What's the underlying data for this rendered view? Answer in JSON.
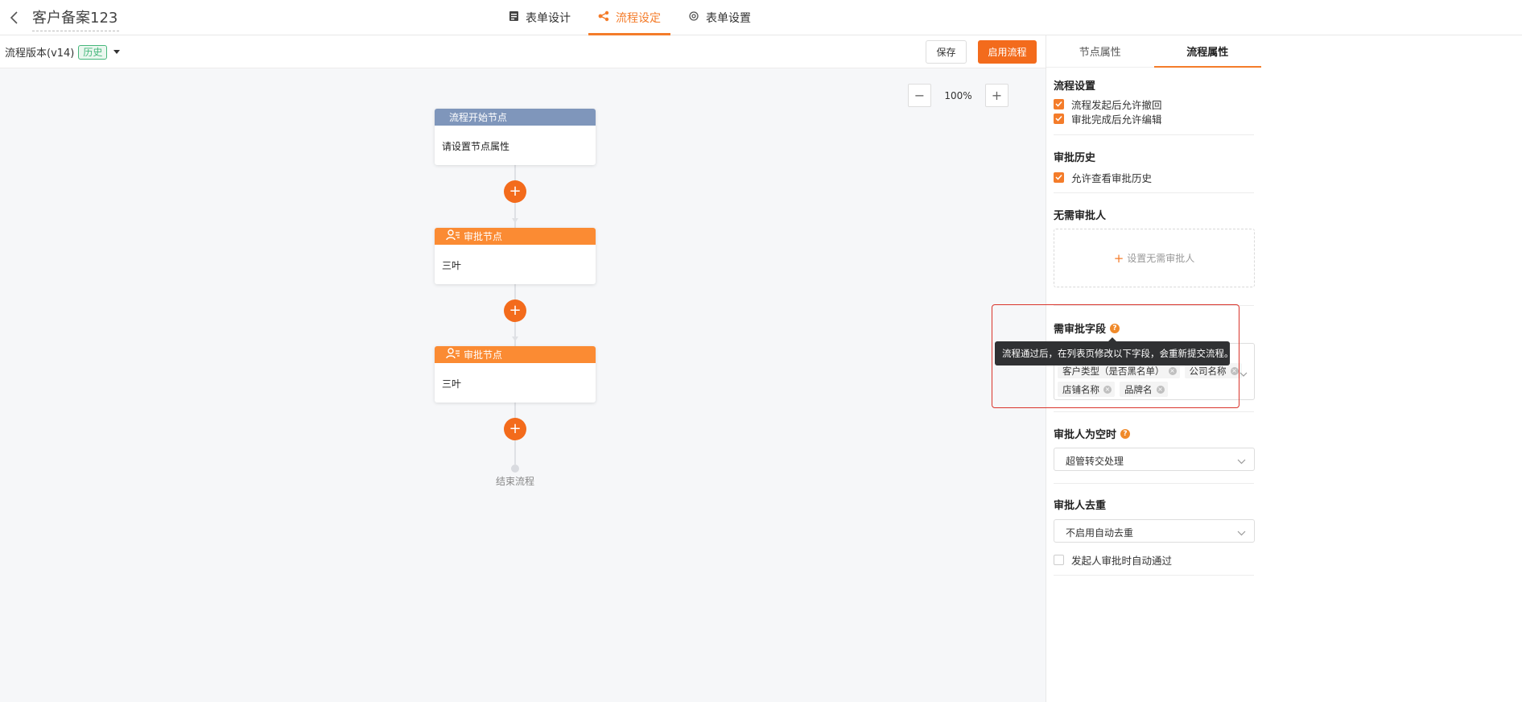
{
  "header": {
    "doc_title": "客户备案123",
    "tabs": [
      {
        "label": "表单设计",
        "icon": "form-icon",
        "active": false
      },
      {
        "label": "流程设定",
        "icon": "flow-icon",
        "active": true
      },
      {
        "label": "表单设置",
        "icon": "gear-icon",
        "active": false
      }
    ]
  },
  "toolbar": {
    "version_label": "流程版本(v14)",
    "history_badge": "历史",
    "save_label": "保存",
    "enable_label": "启用流程"
  },
  "canvas": {
    "zoom_value": "100%",
    "zoom_out": "−",
    "zoom_in": "+",
    "add_symbol": "+",
    "nodes": [
      {
        "type": "start",
        "title": "流程开始节点",
        "body": "请设置节点属性"
      },
      {
        "type": "approve",
        "title": "审批节点",
        "body": "三叶"
      },
      {
        "type": "approve",
        "title": "审批节点",
        "body": "三叶"
      }
    ],
    "end_label": "结束流程"
  },
  "panel": {
    "tabs": [
      {
        "label": "节点属性",
        "active": false
      },
      {
        "label": "流程属性",
        "active": true
      }
    ],
    "flow_settings": {
      "title": "流程设置",
      "options": [
        {
          "label": "流程发起后允许撤回",
          "checked": true
        },
        {
          "label": "审批完成后允许编辑",
          "checked": true
        }
      ]
    },
    "approval_history": {
      "title": "审批历史",
      "option": {
        "label": "允许查看审批历史",
        "checked": true
      }
    },
    "no_approver": {
      "title": "无需审批人",
      "add_label": "设置无需审批人"
    },
    "approval_fields": {
      "title": "需审批字段",
      "tooltip": "流程通过后，在列表页修改以下字段，会重新提交流程。",
      "tags": [
        "客户类型（是否黑名单）",
        "公司名称",
        "店铺名称",
        "品牌名"
      ]
    },
    "empty_approver": {
      "title": "审批人为空时",
      "value": "超管转交处理"
    },
    "dedupe": {
      "title": "审批人去重",
      "value": "不启用自动去重",
      "option": {
        "label": "发起人审批时自动通过",
        "checked": false
      }
    }
  },
  "colors": {
    "accent": "#f47c2a",
    "start_node": "#7f96bb",
    "approve_node": "#fb8b33",
    "highlight": "#d9342b"
  }
}
